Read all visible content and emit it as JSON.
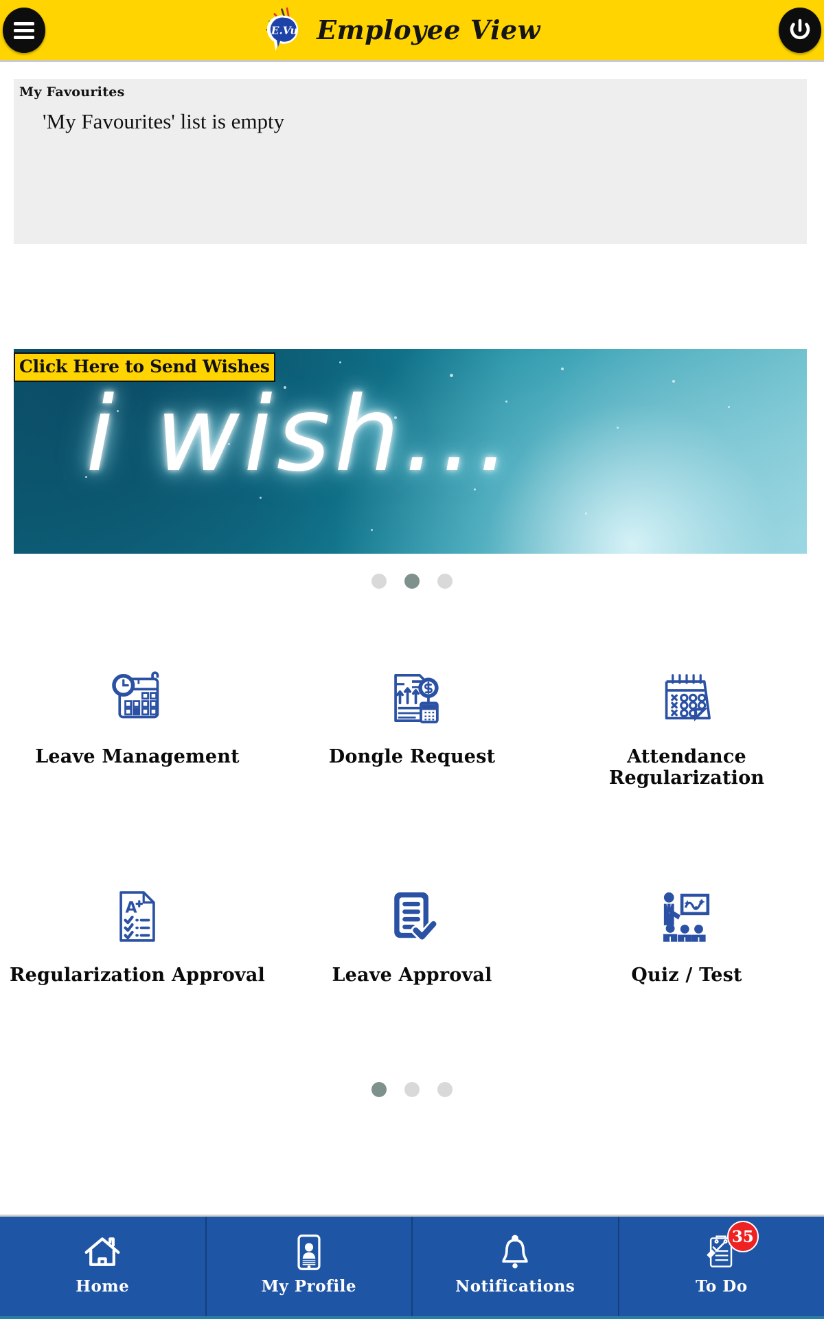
{
  "header": {
    "title": "Employee View",
    "logo_text": "E.Vu",
    "menu_icon": "hamburger-menu-icon",
    "power_icon": "power-icon"
  },
  "favourites": {
    "title": "My Favourites",
    "empty_message": "'My Favourites' list is empty"
  },
  "banner": {
    "cta_label": "Click Here to Send Wishes",
    "image_text": "i wish...",
    "dots": [
      {
        "active": false
      },
      {
        "active": true
      },
      {
        "active": false
      }
    ]
  },
  "grid": {
    "items": [
      {
        "label": "Leave Management",
        "icon": "calendar-clock-icon"
      },
      {
        "label": "Dongle Request",
        "icon": "document-dollar-calculator-icon"
      },
      {
        "label": "Attendance Regularization",
        "icon": "calendar-xo-icon"
      },
      {
        "label": "Regularization Approval",
        "icon": "document-grade-checklist-icon"
      },
      {
        "label": "Leave Approval",
        "icon": "document-check-icon"
      },
      {
        "label": "Quiz / Test",
        "icon": "presentation-training-icon"
      }
    ],
    "dots": [
      {
        "active": true
      },
      {
        "active": false
      },
      {
        "active": false
      }
    ]
  },
  "bottom_nav": {
    "items": [
      {
        "label": "Home",
        "icon": "home-icon",
        "badge": null
      },
      {
        "label": "My Profile",
        "icon": "profile-card-icon",
        "badge": null
      },
      {
        "label": "Notifications",
        "icon": "bell-icon",
        "badge": null
      },
      {
        "label": "To Do",
        "icon": "clipboard-pen-icon",
        "badge": "35"
      }
    ]
  },
  "colors": {
    "header_yellow": "#ffd400",
    "nav_blue": "#1f55a5",
    "icon_blue": "#2a51a3",
    "badge_red": "#ee2222",
    "panel_gray": "#eeeeee"
  }
}
